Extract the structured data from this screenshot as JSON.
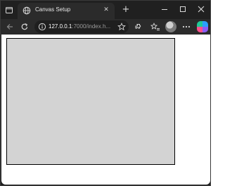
{
  "tab": {
    "title": "Canvas Setup",
    "close_glyph": "✕"
  },
  "new_tab_glyph": "+",
  "address_bar": {
    "url_host": "127.0.0.1",
    "url_rest": ":7000/index.h..."
  },
  "icons": {
    "tab_actions": "tab-actions-icon",
    "globe": "globe-icon",
    "back": "back-arrow-icon",
    "refresh": "refresh-icon",
    "info": "site-info-icon",
    "favorite": "star-icon",
    "extensions": "extensions-icon",
    "collections": "favorites-icon",
    "profile": "profile-avatar",
    "more": "more-icon",
    "copilot": "copilot-icon"
  },
  "colors": {
    "titlebar": "#202020",
    "toolbar": "#2b2b2b",
    "canvas_fill": "#d3d3d3",
    "canvas_border": "#000000",
    "page_bg": "#ffffff"
  }
}
